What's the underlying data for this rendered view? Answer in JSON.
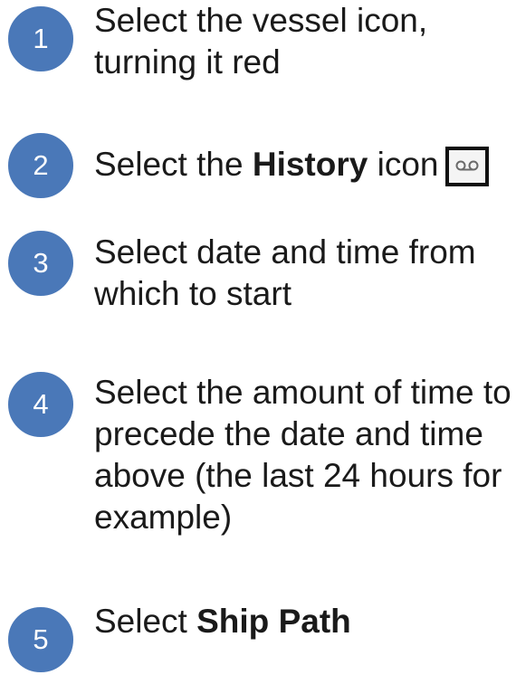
{
  "steps": [
    {
      "number": "1",
      "text": "Select the vessel icon, turning it red"
    },
    {
      "number": "2",
      "prefix": "Select the ",
      "bold": "History",
      "suffix": " icon",
      "icon": "voicemail-icon"
    },
    {
      "number": "3",
      "text": "Select date and time from which to start"
    },
    {
      "number": "4",
      "text": "Select the amount of time to precede the date and time above (the last 24 hours for example)"
    },
    {
      "number": "5",
      "prefix": "Select ",
      "bold": "Ship Path"
    }
  ],
  "colors": {
    "circle": "#4a78b8",
    "text": "#1a1a1a"
  }
}
